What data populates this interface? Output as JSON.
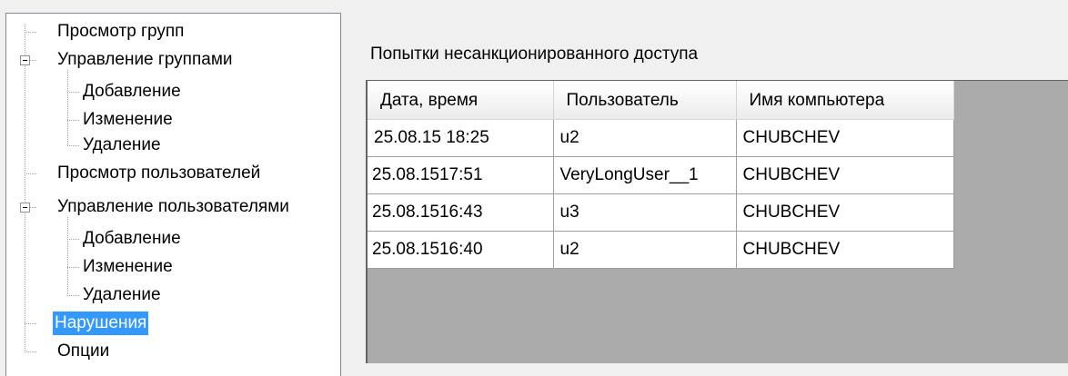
{
  "tree": {
    "items": [
      {
        "label": "Просмотр групп"
      },
      {
        "label": "Управление группами"
      },
      {
        "label": "Добавление"
      },
      {
        "label": "Изменение"
      },
      {
        "label": "Удаление"
      },
      {
        "label": "Просмотр пользователей"
      },
      {
        "label": "Управление пользователями"
      },
      {
        "label": "Добавление"
      },
      {
        "label": "Изменение"
      },
      {
        "label": "Удаление"
      },
      {
        "label": "Нарушения",
        "selected": true
      },
      {
        "label": "Опции"
      }
    ],
    "selection_color": "#3399ff"
  },
  "panel": {
    "title": "Попытки несанкционированного доступа"
  },
  "grid": {
    "columns": [
      "Дата, время",
      "Пользователь",
      "Имя компьютера"
    ],
    "rows": [
      [
        "25.08.15 18:25",
        "u2",
        "CHUBCHEV"
      ],
      [
        "25.08.1517:51",
        "VeryLongUser__1",
        "CHUBCHEV"
      ],
      [
        "25.08.1516:43",
        "u3",
        "CHUBCHEV"
      ],
      [
        "25.08.1516:40",
        "u2",
        "CHUBCHEV"
      ]
    ],
    "background_color": "#ababab"
  }
}
